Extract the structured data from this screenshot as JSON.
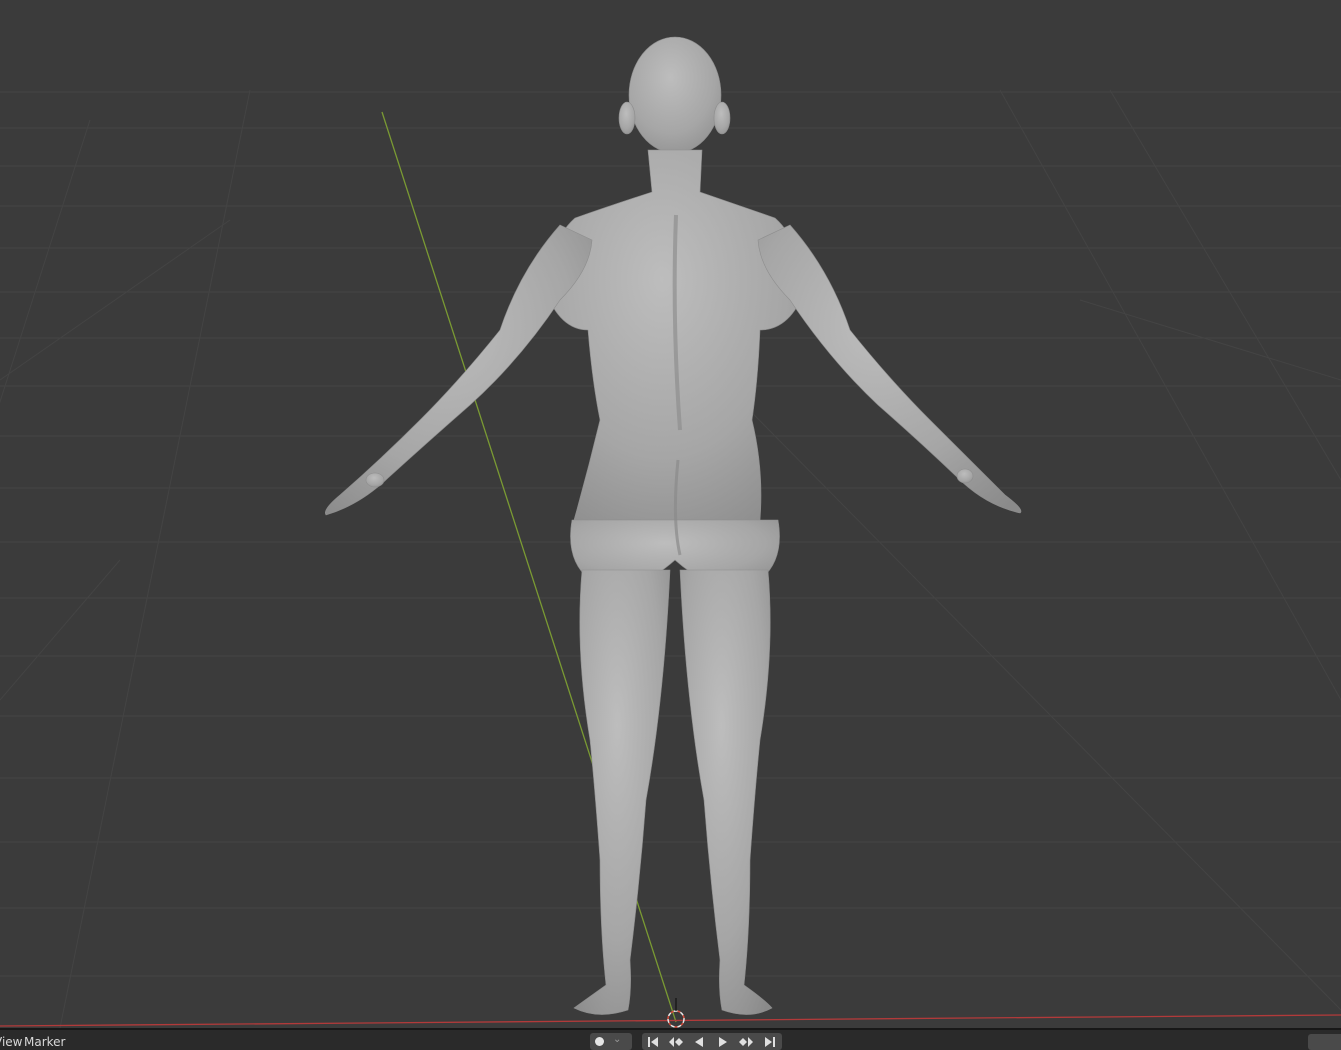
{
  "timeline": {
    "menu_view": "View",
    "menu_marker": "Marker"
  },
  "icons": {
    "keyframe": "keyframe-dot-icon",
    "chevron": "chevron-down-icon",
    "jump_start": "jump-to-start-icon",
    "prev_keyframe": "previous-keyframe-icon",
    "play_reverse": "play-reverse-icon",
    "play": "play-icon",
    "next_keyframe": "next-keyframe-icon",
    "jump_end": "jump-to-end-icon",
    "cursor_3d": "3d-cursor-icon"
  },
  "colors": {
    "viewport_bg": "#3b3b3b",
    "grid_line": "#444444",
    "y_axis": "#7a9a33",
    "x_axis": "#b23a3a",
    "mesh": "#a8a8a8"
  }
}
